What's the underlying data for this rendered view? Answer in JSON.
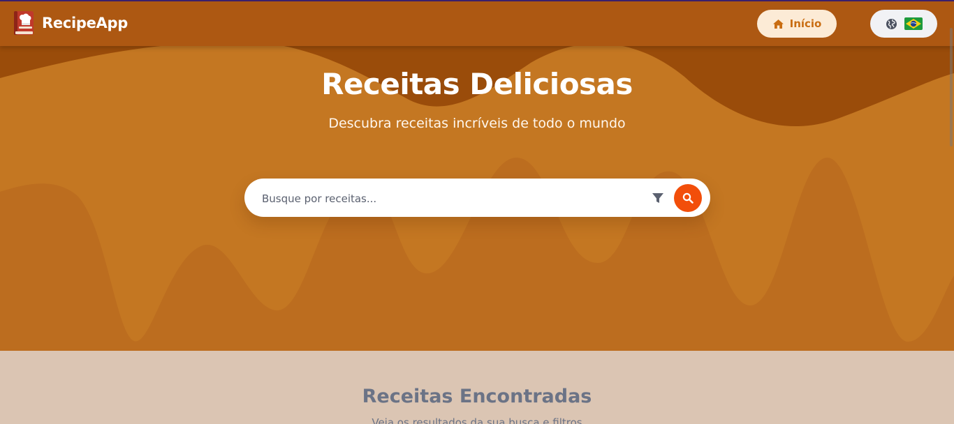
{
  "header": {
    "brand_name": "RecipeApp",
    "home_label": "Início",
    "home_icon": "home-icon",
    "lang_icon": "globe-icon",
    "flag_icon": "brazil-flag-icon"
  },
  "hero": {
    "title": "Receitas Deliciosas",
    "subtitle": "Descubra receitas incríveis de todo o mundo"
  },
  "search": {
    "placeholder": "Busque por receitas...",
    "value": "",
    "filter_icon": "filter-icon",
    "search_icon": "search-icon"
  },
  "results": {
    "title": "Receitas Encontradas",
    "subtitle": "Veja os resultados da sua busca e filtros"
  },
  "colors": {
    "header_bg": "#ad5812",
    "hero_bg": "#c47722",
    "accent": "#f24e0a",
    "home_button_bg": "#fcebd6",
    "home_button_text": "#c96d12",
    "results_bg": "#dbc5b3"
  }
}
